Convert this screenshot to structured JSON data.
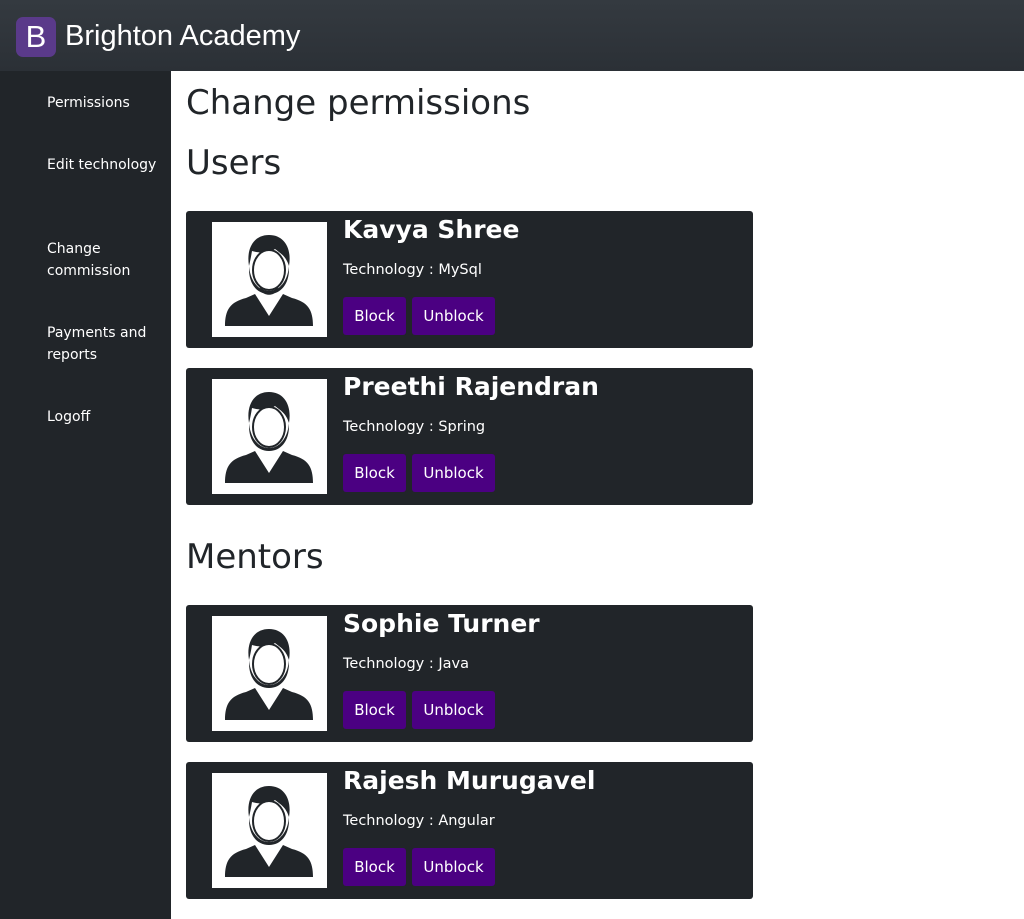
{
  "header": {
    "logo_letter": "B",
    "app_name": "Brighton Academy",
    "logo_color": "#5a3a8a"
  },
  "sidebar": {
    "items": [
      {
        "label": "Permissions"
      },
      {
        "label": "Edit technology"
      },
      {
        "label": "Change commission"
      },
      {
        "label": "Payments and reports"
      },
      {
        "label": "Logoff"
      }
    ]
  },
  "main": {
    "page_title": "Change permissions",
    "users_title": "Users",
    "mentors_title": "Mentors",
    "tech_prefix": "Technology : ",
    "block_label": "Block",
    "unblock_label": "Unblock",
    "users": [
      {
        "name": "Kavya Shree",
        "technology": "Technology : MySql"
      },
      {
        "name": "Preethi Rajendran",
        "technology": "Technology : Spring"
      }
    ],
    "mentors": [
      {
        "name": "Sophie Turner",
        "technology": "Technology : Java"
      },
      {
        "name": "Rajesh Murugavel",
        "technology": "Technology : Angular"
      }
    ]
  },
  "colors": {
    "topbar": "#343a40",
    "sidebar": "#212529",
    "card": "#212529",
    "button": "#4b0082"
  },
  "icons": {
    "avatar": "user-avatar-icon"
  }
}
